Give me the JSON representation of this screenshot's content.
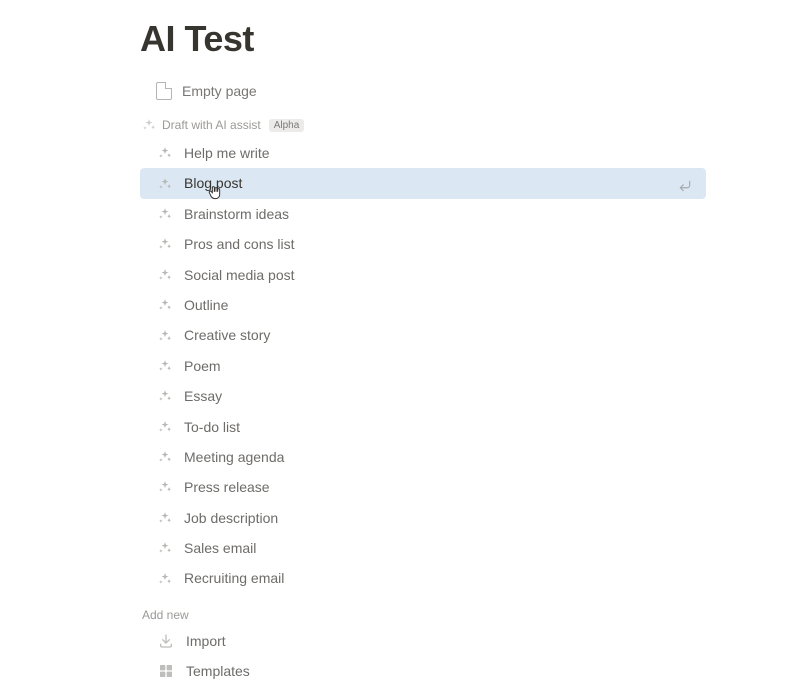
{
  "page": {
    "title": "AI Test",
    "empty_label": "Empty page"
  },
  "ai_section": {
    "header": "Draft with AI assist",
    "badge": "Alpha",
    "items": [
      {
        "label": "Help me write"
      },
      {
        "label": "Blog post",
        "selected": true
      },
      {
        "label": "Brainstorm ideas"
      },
      {
        "label": "Pros and cons list"
      },
      {
        "label": "Social media post"
      },
      {
        "label": "Outline"
      },
      {
        "label": "Creative story"
      },
      {
        "label": "Poem"
      },
      {
        "label": "Essay"
      },
      {
        "label": "To-do list"
      },
      {
        "label": "Meeting agenda"
      },
      {
        "label": "Press release"
      },
      {
        "label": "Job description"
      },
      {
        "label": "Sales email"
      },
      {
        "label": "Recruiting email"
      }
    ]
  },
  "addnew_section": {
    "header": "Add new",
    "items": [
      {
        "label": "Import",
        "icon": "import"
      },
      {
        "label": "Templates",
        "icon": "templates"
      }
    ]
  }
}
